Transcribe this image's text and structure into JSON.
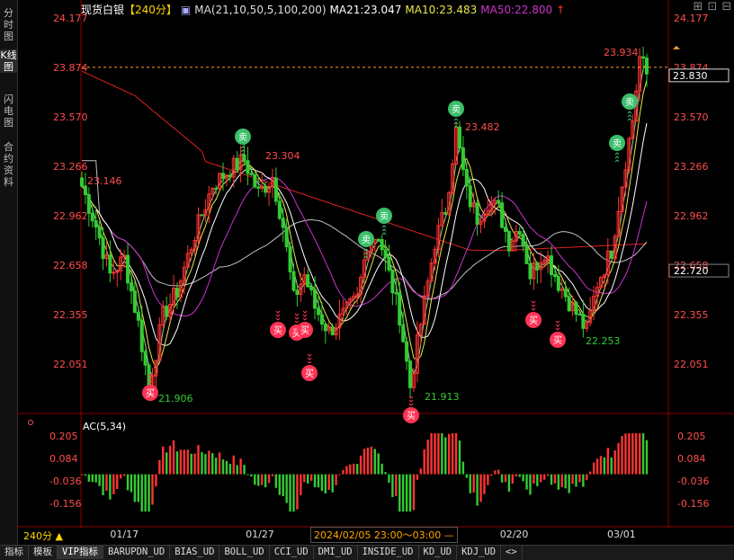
{
  "left_tabs": [
    "分时图",
    "K线图",
    "闪电图",
    "合约资料"
  ],
  "header": {
    "symbol": "现货白银",
    "period": "【240分】",
    "ma_def": "MA(21,10,50,5,100,200)",
    "ma21": "MA21:23.047",
    "ma10": "MA10:23.483",
    "ma50": "MA50:22.800",
    "icon": "candlestick-icon",
    "arrow": "↑"
  },
  "window_controls": [
    "⊞",
    "⊡",
    "⊟"
  ],
  "period_button": "240分 ▲",
  "date_tip": "2024/02/05 23:00～03:00 —",
  "bottom_tabs": [
    "指标",
    "模板",
    "VIP指标",
    "BARUPDN_UD",
    "BIAS_UD",
    "BOLL_UD",
    "CCI_UD",
    "DMI_UD",
    "INSIDE_UD",
    "KD_UD",
    "KDJ_UD",
    "<>"
  ],
  "colors": {
    "up": "#ff3333",
    "down": "#33cc33",
    "ma21": "#ffffff",
    "ma10": "#e8e84a",
    "ma50": "#cc33cc",
    "ma100": "#bfbfbf",
    "ma200": "#e02020",
    "axis": "#ff4d4d",
    "buy": "#ff3355",
    "sell": "#3bbf6a",
    "price": "#ff9933"
  },
  "chart_data": {
    "type": "candlestick",
    "price_axis": {
      "ticks": [
        24.177,
        23.874,
        23.57,
        23.266,
        22.962,
        22.658,
        22.355,
        22.051
      ]
    },
    "current_price": "23.830",
    "current_ref": "23.874",
    "right_marker": "22.720",
    "x_labels": [
      "01/17",
      "01/27",
      "02/20",
      "03/01"
    ],
    "ohlc_anchors": [
      [
        0,
        23.146
      ],
      [
        4,
        22.9
      ],
      [
        8,
        22.6
      ],
      [
        12,
        22.7
      ],
      [
        16,
        22.3
      ],
      [
        19,
        21.906
      ],
      [
        23,
        22.35
      ],
      [
        27,
        22.5
      ],
      [
        32,
        22.85
      ],
      [
        37,
        23.15
      ],
      [
        42,
        23.25
      ],
      [
        46,
        23.304
      ],
      [
        50,
        23.1
      ],
      [
        54,
        23.2
      ],
      [
        57,
        22.9
      ],
      [
        60,
        22.45
      ],
      [
        63,
        22.6
      ],
      [
        66,
        22.4
      ],
      [
        70,
        22.25
      ],
      [
        74,
        22.35
      ],
      [
        78,
        22.45
      ],
      [
        81,
        22.8
      ],
      [
        84,
        22.85
      ],
      [
        87,
        22.6
      ],
      [
        90,
        22.35
      ],
      [
        93,
        21.913
      ],
      [
        96,
        22.3
      ],
      [
        100,
        22.8
      ],
      [
        103,
        23.0
      ],
      [
        106,
        23.482
      ],
      [
        109,
        23.1
      ],
      [
        112,
        22.95
      ],
      [
        115,
        23.05
      ],
      [
        118,
        23.0
      ],
      [
        121,
        22.8
      ],
      [
        124,
        22.9
      ],
      [
        127,
        22.6
      ],
      [
        131,
        22.75
      ],
      [
        135,
        22.55
      ],
      [
        139,
        22.4
      ],
      [
        143,
        22.253
      ],
      [
        146,
        22.55
      ],
      [
        150,
        22.75
      ],
      [
        154,
        23.3
      ],
      [
        156,
        23.55
      ],
      [
        158,
        23.934
      ],
      [
        160,
        23.83
      ]
    ],
    "max_label": "23.934",
    "min_label": "21.906",
    "annotations": [
      "23.146",
      "23.304",
      "23.482",
      "21.913",
      "22.253"
    ],
    "buy_label": "买",
    "sell_label": "卖",
    "ac": {
      "title": "AC(5,34)",
      "ticks": [
        0.205,
        0.084,
        -0.036,
        -0.156
      ],
      "values_desc": "oscillator"
    }
  }
}
